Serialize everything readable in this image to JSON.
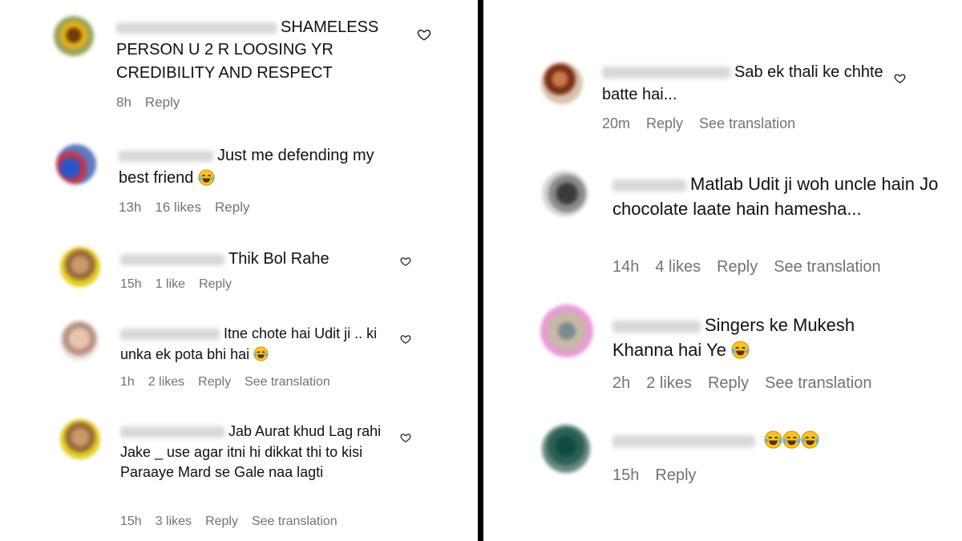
{
  "left_comments": [
    {
      "text": "SHAMELESS PERSON U 2 R LOOSING YR CREDIBILITY AND RESPECT",
      "time": "8h",
      "likes": "",
      "reply": "Reply",
      "see_translation": ""
    },
    {
      "text": "Just me defending my best friend",
      "emoji": "😂",
      "time": "13h",
      "likes": "16 likes",
      "reply": "Reply",
      "see_translation": ""
    },
    {
      "text": "Thik Bol Rahe",
      "time": "15h",
      "likes": "1 like",
      "reply": "Reply",
      "see_translation": ""
    },
    {
      "text": "Itne chote hai Udit ji .. ki unka ek pota bhi hai",
      "emoji": "😂",
      "time": "1h",
      "likes": "2 likes",
      "reply": "Reply",
      "see_translation": "See translation"
    },
    {
      "text": "Jab Aurat khud Lag rahi Jake _ use agar itni hi dikkat thi to kisi Paraaye Mard se Gale naa lagti",
      "time": "15h",
      "likes": "3 likes",
      "reply": "Reply",
      "see_translation": "See translation"
    }
  ],
  "right_comments": [
    {
      "text": "Sab ek thali ke chhte batte hai...",
      "time": "20m",
      "likes": "",
      "reply": "Reply",
      "see_translation": "See translation"
    },
    {
      "text": "Matlab Udit ji woh uncle hain Jo chocolate laate hain hamesha...",
      "time": "14h",
      "likes": "4 likes",
      "reply": "Reply",
      "see_translation": "See translation"
    },
    {
      "text": "Singers ke Mukesh Khanna hai Ye",
      "emoji": "😂",
      "time": "2h",
      "likes": "2 likes",
      "reply": "Reply",
      "see_translation": "See translation"
    },
    {
      "text": "",
      "emoji": "😂😂😂",
      "time": "15h",
      "likes": "",
      "reply": "Reply",
      "see_translation": ""
    }
  ],
  "icons": {
    "like": "heart-outline-icon",
    "emoji": "face-with-tears-of-joy-emoji"
  },
  "colors": {
    "meta_text": "#737373",
    "divider": "#000000"
  }
}
